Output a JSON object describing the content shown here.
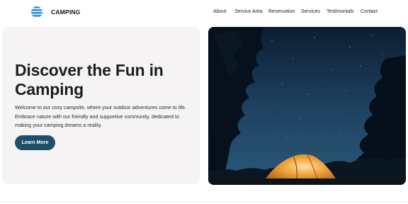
{
  "header": {
    "brand": "CAMPING",
    "nav": [
      {
        "label": "About"
      },
      {
        "label": "Service Area"
      },
      {
        "label": "Reservation"
      },
      {
        "label": "Services"
      },
      {
        "label": "Testimonials"
      },
      {
        "label": "Contact"
      }
    ]
  },
  "hero": {
    "title_line1": "Discover the Fun in",
    "title_line2": "Camping",
    "description": "Welcome to our cozy campsite, where your outdoor adventures come to life. Embrace nature with our friendly and supportive community, dedicated to making your camping dreams a reality.",
    "cta_label": "Learn More"
  },
  "colors": {
    "accent": "#1d4f6b",
    "logo": "#2e8de8",
    "card_bg": "#f5f3f4"
  }
}
